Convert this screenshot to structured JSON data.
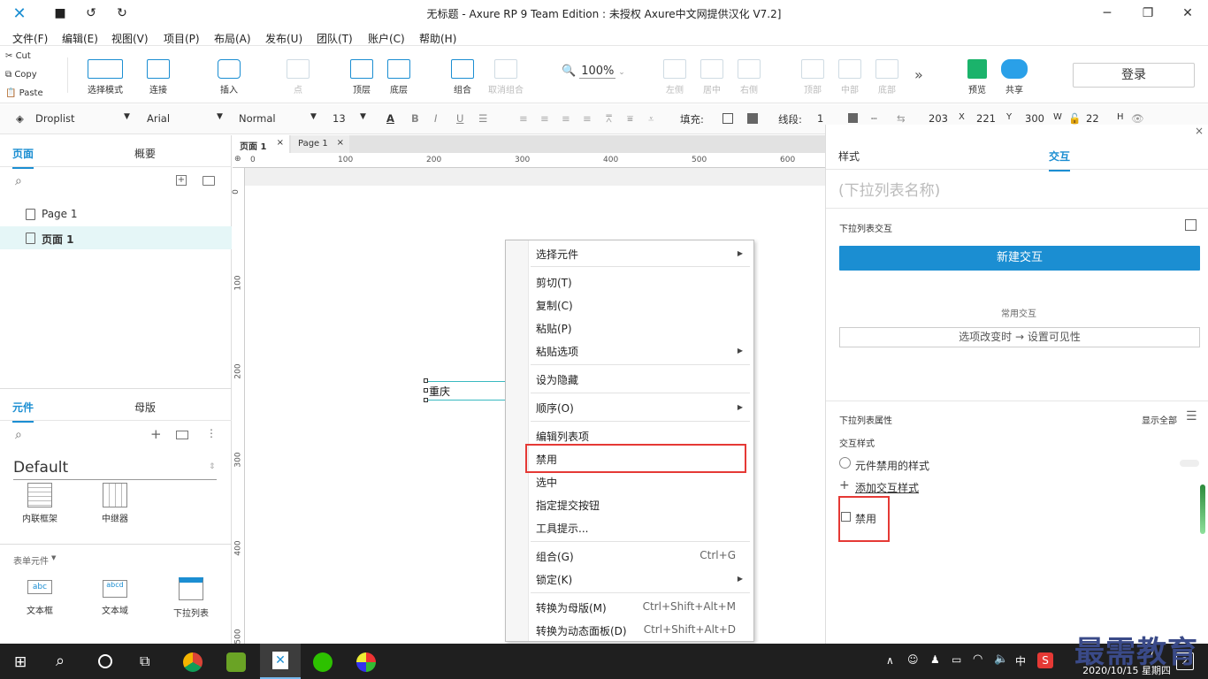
{
  "window": {
    "title": "无标题 - Axure RP 9 Team Edition : 未授权    Axure中文网提供汉化 V7.2]"
  },
  "menu": [
    "文件(F)",
    "编辑(E)",
    "视图(V)",
    "项目(P)",
    "布局(A)",
    "发布(U)",
    "团队(T)",
    "账户(C)",
    "帮助(H)"
  ],
  "clipboard": {
    "cut": "Cut",
    "copy": "Copy",
    "paste": "Paste"
  },
  "toolbar": {
    "select_mode": "选择模式",
    "connect": "连接",
    "insert": "插入",
    "point": "点",
    "front": "顶层",
    "back": "底层",
    "group": "组合",
    "ungroup": "取消组合",
    "zoom": "100%",
    "left": "左侧",
    "center": "居中",
    "right": "右侧",
    "top": "顶部",
    "middle": "中部",
    "bottom": "底部",
    "preview": "预览",
    "share": "共享",
    "login": "登录"
  },
  "format": {
    "widget": "Droplist",
    "font": "Arial",
    "style": "Normal",
    "size": "13",
    "fill_label": "填充:",
    "line_label": "线段:",
    "line_val": "1",
    "x_val": "203",
    "x_lbl": "X",
    "y_val": "221",
    "y_lbl": "Y",
    "w_val": "300",
    "w_lbl": "W",
    "h_val": "22",
    "h_lbl": "H"
  },
  "pages_panel": {
    "tab_pages": "页面",
    "tab_outline": "概要",
    "items": [
      "Page 1",
      "页面 1"
    ]
  },
  "widgets_panel": {
    "tab_widgets": "元件",
    "tab_masters": "母版",
    "library": "Default",
    "items_top": [
      "内联框架",
      "中继器"
    ],
    "section": "表单元件",
    "items_form": [
      "文本框",
      "文本域",
      "下拉列表"
    ]
  },
  "canvas_tabs": [
    "页面 1",
    "Page 1"
  ],
  "ruler_h": [
    "0",
    "100",
    "200",
    "300",
    "400",
    "500",
    "600"
  ],
  "ruler_v": [
    "0",
    "100",
    "200",
    "300",
    "400",
    "500"
  ],
  "widget_text": "重庆",
  "context_menu": {
    "select_widget": "选择元件",
    "cut": "剪切(T)",
    "copy": "复制(C)",
    "paste": "粘贴(P)",
    "paste_options": "粘贴选项",
    "hide": "设为隐藏",
    "order": "顺序(O)",
    "edit_list": "编辑列表项",
    "disable": "禁用",
    "select": "选中",
    "submit": "指定提交按钮",
    "tooltip": "工具提示...",
    "group": "组合(G)",
    "group_sc": "Ctrl+G",
    "lock": "锁定(K)",
    "to_master": "转换为母版(M)",
    "to_master_sc": "Ctrl+Shift+Alt+M",
    "to_dynamic": "转换为动态面板(D)",
    "to_dynamic_sc": "Ctrl+Shift+Alt+D"
  },
  "right_panel": {
    "tab_style": "样式",
    "tab_interact": "交互",
    "name_placeholder": "(下拉列表名称)",
    "section_interactions": "下拉列表交互",
    "new_interaction": "新建交互",
    "common_label": "常用交互",
    "common_action": "选项改变时 → 设置可见性",
    "props_label": "下拉列表属性",
    "show_all": "显示全部",
    "interaction_styles": "交互样式",
    "disabled_style": "元件禁用的样式",
    "add_style": "添加交互样式",
    "disabled": "禁用"
  },
  "taskbar": {
    "time": "7",
    "date": "2020/10/15 星期四",
    "ime": "中"
  },
  "watermark": "最需教育"
}
